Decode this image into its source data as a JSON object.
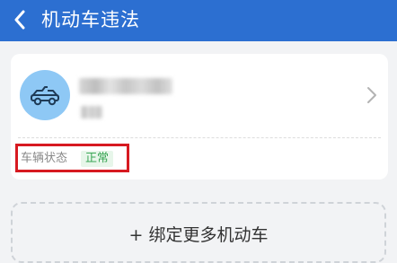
{
  "header": {
    "title": "机动车违法",
    "back_icon": "chevron-left-icon",
    "background": "#2c6fd1"
  },
  "vehicle": {
    "avatar_icon": "car-icon",
    "status_label": "车辆状态",
    "status_value": "正常",
    "status_color": "#3aa655",
    "chevron_icon": "chevron-right-icon",
    "highlight_color": "#d71a21"
  },
  "bind_more": {
    "label": "+ 绑定更多机动车"
  }
}
